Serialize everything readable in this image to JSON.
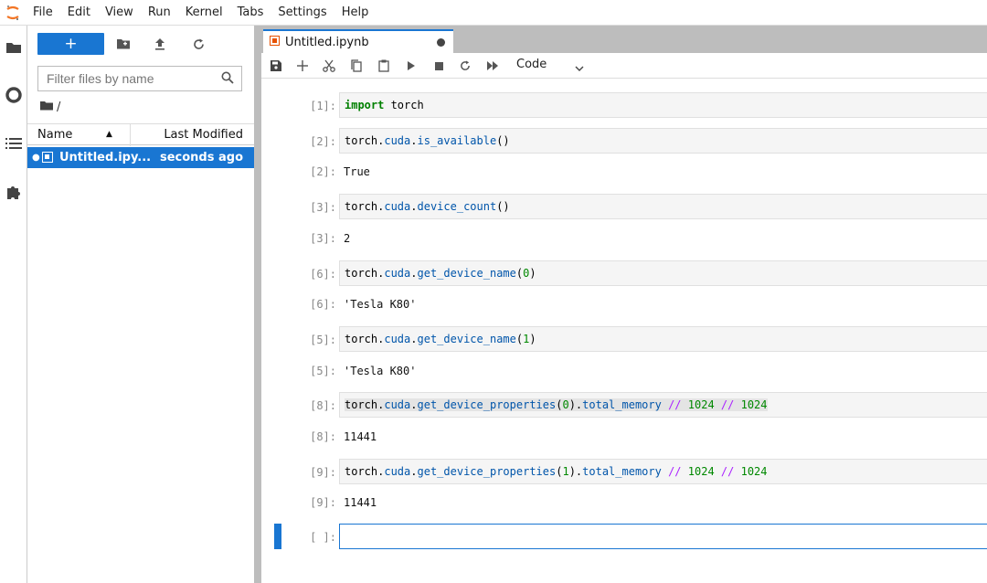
{
  "menubar": {
    "items": [
      "File",
      "Edit",
      "View",
      "Run",
      "Kernel",
      "Tabs",
      "Settings",
      "Help"
    ]
  },
  "filebrowser": {
    "new_label": "+",
    "filter_placeholder": "Filter files by name",
    "breadcrumb": "/",
    "columns": {
      "name": "Name",
      "modified": "Last Modified"
    },
    "files": [
      {
        "name": "Untitled.ipy...",
        "modified": "seconds ago",
        "selected": true
      }
    ]
  },
  "notebook": {
    "tab_label": "Untitled.ipynb",
    "cell_type": "Code",
    "cells": [
      {
        "in_prompt": "[1]:",
        "code": "import torch"
      },
      {
        "in_prompt": "[2]:",
        "code": "torch.cuda.is_available()",
        "out_prompt": "[2]:",
        "output": "True"
      },
      {
        "in_prompt": "[3]:",
        "code": "torch.cuda.device_count()",
        "out_prompt": "[3]:",
        "output": "2"
      },
      {
        "in_prompt": "[6]:",
        "code": "torch.cuda.get_device_name(0)",
        "out_prompt": "[6]:",
        "output": "'Tesla K80'"
      },
      {
        "in_prompt": "[5]:",
        "code": "torch.cuda.get_device_name(1)",
        "out_prompt": "[5]:",
        "output": "'Tesla K80'"
      },
      {
        "in_prompt": "[8]:",
        "code": "torch.cuda.get_device_properties(0).total_memory // 1024 // 1024",
        "out_prompt": "[8]:",
        "output": "11441"
      },
      {
        "in_prompt": "[9]:",
        "code": "torch.cuda.get_device_properties(1).total_memory // 1024 // 1024",
        "out_prompt": "[9]:",
        "output": "11441"
      },
      {
        "in_prompt": "[ ]:",
        "code": ""
      }
    ]
  },
  "colors": {
    "accent": "#1976d2",
    "notebook_icon": "#e65100",
    "splitter": "#bdbdbd"
  }
}
